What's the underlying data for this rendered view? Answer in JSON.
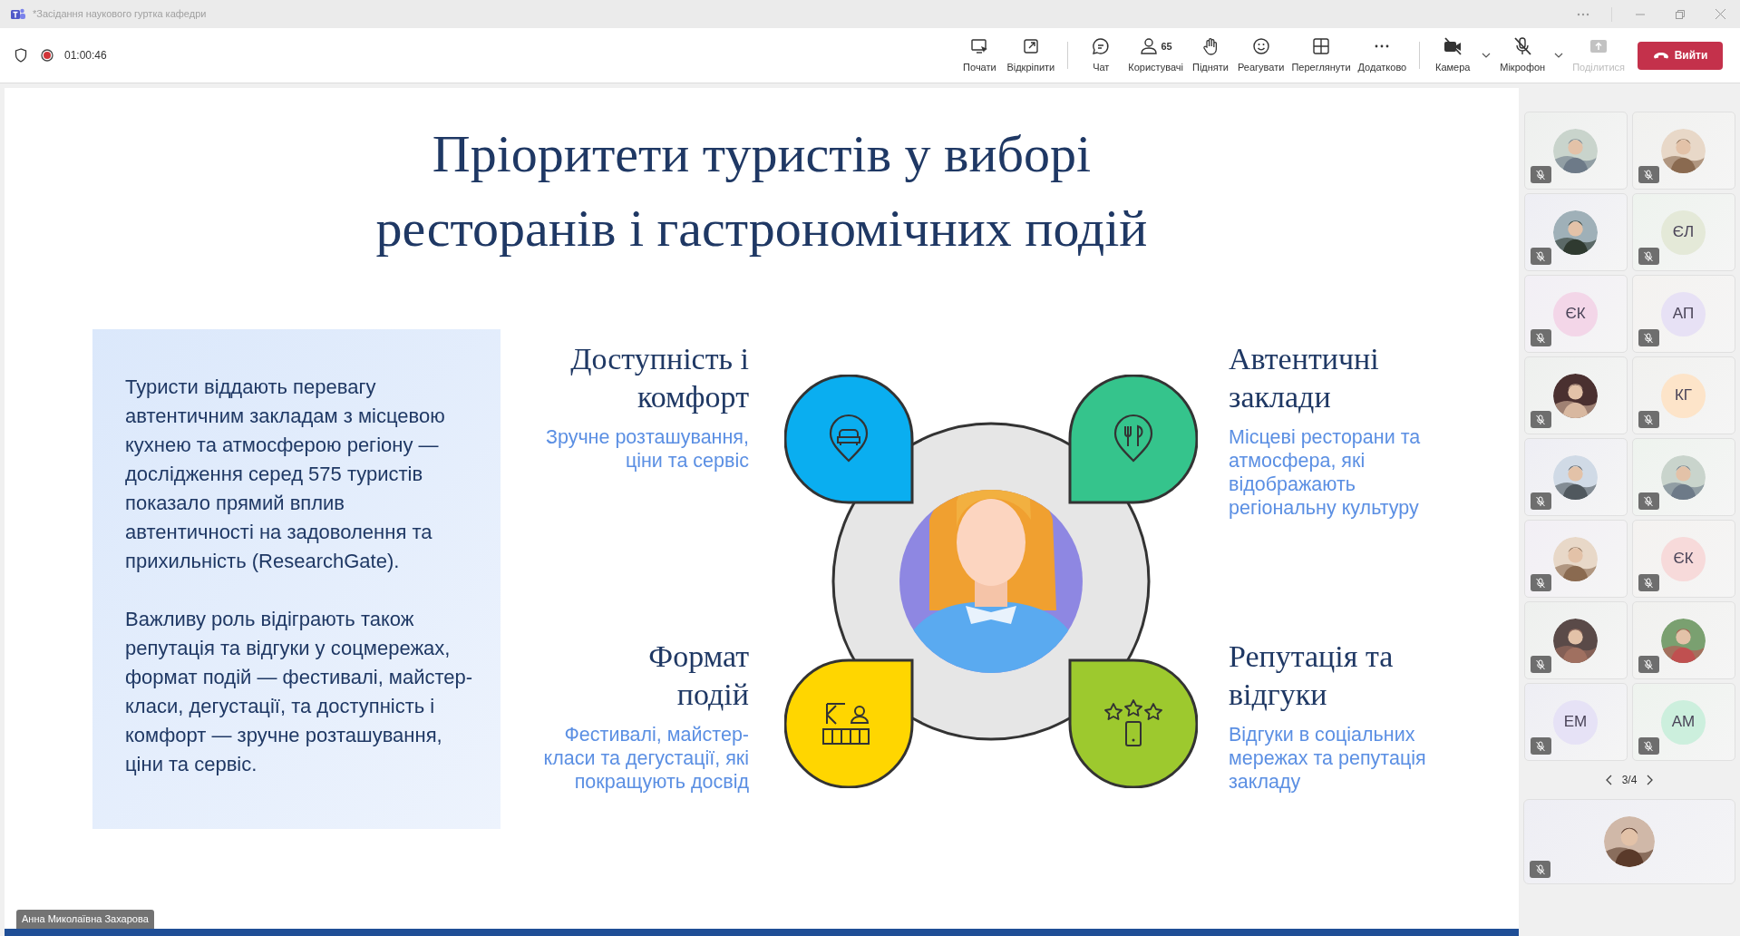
{
  "window": {
    "title": "*Засідання наукового гуртка кафедри"
  },
  "meeting_bar": {
    "timer": "01:00:46",
    "recording": true,
    "buttons": [
      {
        "kind": "start",
        "label": "Почати",
        "disabled": false
      },
      {
        "kind": "undock",
        "label": "Відкріпити",
        "disabled": false
      },
      {
        "kind": "chat",
        "label": "Чат",
        "disabled": false
      },
      {
        "kind": "people",
        "label": "Користувачі",
        "count": "65",
        "disabled": false
      },
      {
        "kind": "hand",
        "label": "Підняти",
        "disabled": false
      },
      {
        "kind": "react",
        "label": "Реагувати",
        "disabled": false
      },
      {
        "kind": "view",
        "label": "Переглянути",
        "disabled": false
      },
      {
        "kind": "more",
        "label": "Додатково",
        "disabled": false
      },
      {
        "kind": "camera",
        "label": "Камера",
        "on": false,
        "disabled": false
      },
      {
        "kind": "mic",
        "label": "Мікрофон",
        "on": false,
        "disabled": false
      },
      {
        "kind": "share",
        "label": "Поділитися",
        "disabled": true
      }
    ],
    "leave_button": "Вийти"
  },
  "slide": {
    "title": "Пріоритети туристів у виборі ресторанів і гастрономічних подій",
    "summary": [
      "Туристи віддають перевагу автентичним закладам з місцевою кухнею та атмосферою регіону — дослідження серед 575 туристів показало прямий вплив автентичності на задоволення та прихильність (ResearchGate).",
      "Важливу роль відіграють також репутація та відгуки у соцмережах, формат подій — фестивалі, майстер-класи, дегустації, та доступність і комфорт — зручне розташування, ціни та сервіс."
    ],
    "factors": [
      {
        "heading": "Доступність і\nкомфорт",
        "description": "Зручне розташування,\nціни та сервіс",
        "color": "#0aaef0"
      },
      {
        "heading": "Автентичні\nзаклади",
        "description": "Місцеві ресторани та\nатмосфера, які\nвідображають\nрегіональну культуру",
        "color": "#35c48c"
      },
      {
        "heading": "Формат\nподій",
        "description": "Фестивалі, майстер-\nкласи та дегустації, які\nпокращують досвід",
        "color": "#ffd600"
      },
      {
        "heading": "Репутація та\nвідгуки",
        "description": "Відгуки в соціальних\nмережах та репутація\nзакладу",
        "color": "#9dc92e"
      }
    ]
  },
  "presenter_name": "Анна Миколаївна Захарова",
  "participants": {
    "tiles": [
      {
        "kind": "picture",
        "muted": true
      },
      {
        "kind": "picture",
        "muted": true
      },
      {
        "kind": "picture",
        "muted": true
      },
      {
        "kind": "initials",
        "initials": "ЄЛ",
        "color": "#e4e9d8",
        "muted": true
      },
      {
        "kind": "initials",
        "initials": "ЄК",
        "color": "#f3d6e8",
        "muted": true
      },
      {
        "kind": "initials",
        "initials": "АП",
        "color": "#e7e1f5",
        "muted": true
      },
      {
        "kind": "picture",
        "muted": true
      },
      {
        "kind": "initials",
        "initials": "КГ",
        "color": "#fde4c9",
        "muted": true
      },
      {
        "kind": "picture",
        "muted": true
      },
      {
        "kind": "picture",
        "muted": true
      },
      {
        "kind": "picture",
        "muted": true
      },
      {
        "kind": "initials",
        "initials": "ЄК",
        "color": "#f7dada",
        "muted": true
      },
      {
        "kind": "picture",
        "muted": true
      },
      {
        "kind": "picture",
        "muted": true
      },
      {
        "kind": "initials",
        "initials": "ЕМ",
        "color": "#e6e2f6",
        "muted": true
      },
      {
        "kind": "initials",
        "initials": "АМ",
        "color": "#ccefdd",
        "muted": true
      }
    ],
    "pager": "3/4",
    "self_tile": {
      "kind": "picture",
      "muted": true
    }
  }
}
